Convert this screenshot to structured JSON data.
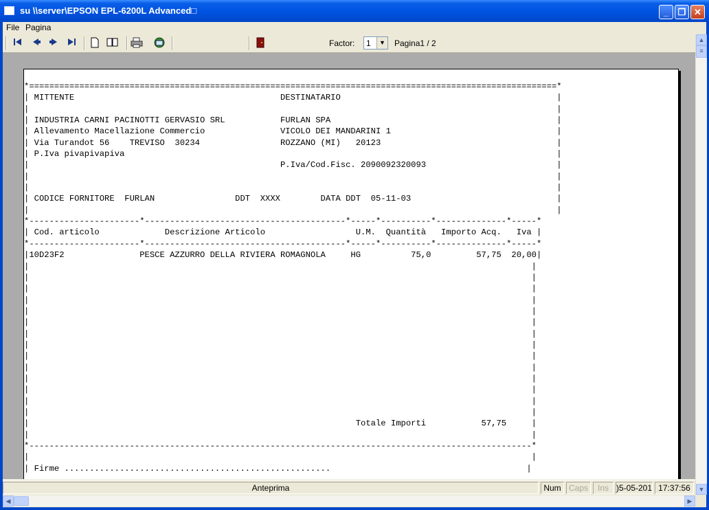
{
  "window": {
    "title": "su \\\\server\\EPSON EPL-6200L Advanced□",
    "minimize": "_",
    "maximize": "❐",
    "close": "✕"
  },
  "menu": [
    "File",
    "Pagina"
  ],
  "toolbar": {
    "factor_label": "Factor:",
    "factor_value": "1",
    "page_label": "Pagina1 / 2",
    "icons": [
      "first-page-icon",
      "prev-page-icon",
      "next-page-icon",
      "last-page-icon",
      "single-page-icon",
      "two-pages-icon",
      "print-icon",
      "export-icon",
      "exit-door-icon"
    ]
  },
  "report_lines": [
    "*=========================================================================================================*",
    "| MITTENTE                                         DESTINATARIO                                           |",
    "|                                                                                                         |",
    "| INDUSTRIA CARNI PACINOTTI GERVASIO SRL           FURLAN SPA                                             |",
    "| Allevamento Macellazione Commercio               VICOLO DEI MANDARINI 1                                 |",
    "| Via Turandot 56    TREVISO  30234                ROZZANO (MI)   20123                                   |",
    "| P.Iva pivapivapiva                                                                                      |",
    "|                                                  P.Iva/Cod.Fisc. 2090092320093                          |",
    "|                                                                                                         |",
    "|                                                                                                         |",
    "| CODICE FORNITORE  FURLAN                DDT  XXXX        DATA DDT  05-11-03                             |",
    "|                                                                                                         |",
    "*----------------------*----------------------------------------*-----*----------*--------------*-----*",
    "| Cod. articolo             Descrizione Articolo                  U.M.  Quantità   Importo Acq.   Iva |",
    "*----------------------*----------------------------------------*-----*----------*--------------*-----*",
    "|10D23F2               PESCE AZZURRO DELLA RIVIERA ROMAGNOLA     HG          75,0         57,75  20,00|",
    "|                                                                                                    |",
    "|                                                                                                    |",
    "|                                                                                                    |",
    "|                                                                                                    |",
    "|                                                                                                    |",
    "|                                                                                                    |",
    "|                                                                                                    |",
    "|                                                                                                    |",
    "|                                                                                                    |",
    "|                                                                                                    |",
    "|                                                                                                    |",
    "|                                                                                                    |",
    "|                                                                                                    |",
    "|                                                                                                    |",
    "|                                                                 Totale Importi           57,75     |",
    "|                                                                                                    |",
    "*----------------------------------------------------------------------------------------------------*",
    "|                                                                                                    |",
    "| Firme .....................................................                                       |"
  ],
  "status": {
    "mode": "Anteprima",
    "num": "Num",
    "caps": "Caps",
    "ins": "Ins",
    "date": ")5-05-2016",
    "time": "17:37:56"
  }
}
